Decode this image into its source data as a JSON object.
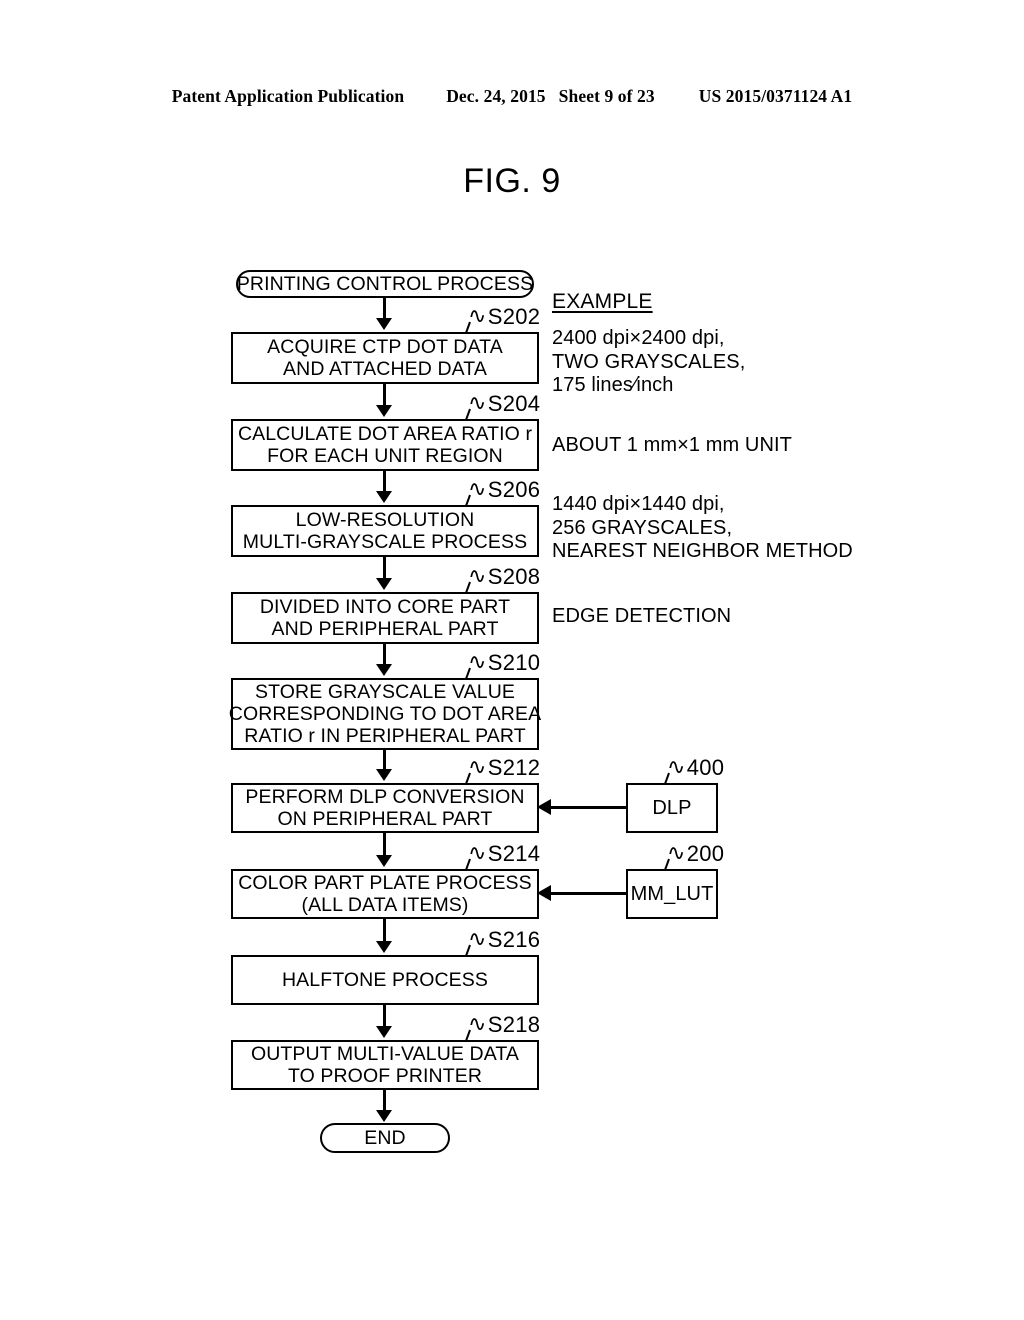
{
  "header": {
    "publication": "Patent Application Publication",
    "date": "Dec. 24, 2015",
    "sheet": "Sheet 9 of 23",
    "doc_number": "US 2015/0371124 A1"
  },
  "figure": {
    "title": "FIG. 9"
  },
  "flowchart": {
    "start": {
      "label": "PRINTING CONTROL PROCESS"
    },
    "end": {
      "label": "END"
    },
    "steps": [
      {
        "id": "S202",
        "lines": [
          "ACQUIRE CTP DOT DATA",
          "AND ATTACHED DATA"
        ]
      },
      {
        "id": "S204",
        "lines": [
          "CALCULATE DOT AREA RATIO r",
          "FOR EACH UNIT REGION"
        ]
      },
      {
        "id": "S206",
        "lines": [
          "LOW-RESOLUTION",
          "MULTI-GRAYSCALE PROCESS"
        ]
      },
      {
        "id": "S208",
        "lines": [
          "DIVIDED INTO CORE PART",
          "AND PERIPHERAL PART"
        ]
      },
      {
        "id": "S210",
        "lines": [
          "STORE GRAYSCALE VALUE",
          "CORRESPONDING TO DOT AREA",
          "RATIO r IN PERIPHERAL PART"
        ]
      },
      {
        "id": "S212",
        "lines": [
          "PERFORM DLP CONVERSION",
          "ON PERIPHERAL PART"
        ]
      },
      {
        "id": "S214",
        "lines": [
          "COLOR PART PLATE PROCESS",
          "(ALL DATA ITEMS)"
        ]
      },
      {
        "id": "S216",
        "lines": [
          "HALFTONE PROCESS"
        ]
      },
      {
        "id": "S218",
        "lines": [
          "OUTPUT MULTI-VALUE DATA",
          "TO PROOF PRINTER"
        ]
      }
    ],
    "side_boxes": [
      {
        "id": "400",
        "label": "DLP",
        "target": "S212"
      },
      {
        "id": "200",
        "label": "MM_LUT",
        "target": "S214"
      }
    ]
  },
  "annotations": {
    "heading": "EXAMPLE",
    "items": [
      {
        "for": "S202",
        "lines": [
          "2400 dpi×2400 dpi,",
          "TWO GRAYSCALES,",
          "175 lines∕inch"
        ]
      },
      {
        "for": "S204",
        "lines": [
          "ABOUT 1 mm×1 mm UNIT"
        ]
      },
      {
        "for": "S206",
        "lines": [
          "1440 dpi×1440 dpi,",
          "256 GRAYSCALES,",
          "NEAREST NEIGHBOR METHOD"
        ]
      },
      {
        "for": "S208",
        "lines": [
          "EDGE DETECTION"
        ]
      }
    ]
  },
  "leader_marks": {
    "tilde": "∿"
  }
}
